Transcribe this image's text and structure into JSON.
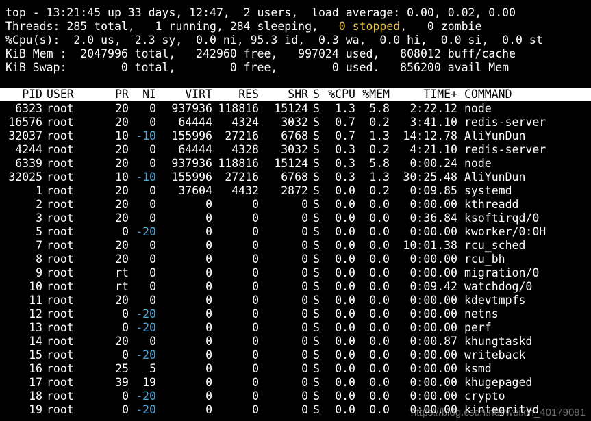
{
  "summary": {
    "line1": "top - 13:21:45 up 33 days, 12:47,  2 users,  load average: 0.00, 0.02, 0.00",
    "line2_before": "Threads: 285 total,   1 running, 284 sleeping,   ",
    "line2_stopped_count": "0",
    "line2_stopped_label": "stopped",
    "line2_after": ",   0 zombie",
    "line3": "%Cpu(s):  2.0 us,  2.3 sy,  0.0 ni, 95.3 id,  0.3 wa,  0.0 hi,  0.0 si,  0.0 st",
    "line4": "KiB Mem :  2047996 total,   242960 free,   997024 used,   808012 buff/cache",
    "line5": "KiB Swap:        0 total,        0 free,        0 used.   856200 avail Mem"
  },
  "columns": {
    "pid": "PID",
    "user": "USER",
    "pr": "PR",
    "ni": "NI",
    "virt": "VIRT",
    "res": "RES",
    "shr": "SHR",
    "s": "S",
    "cpu": "%CPU",
    "mem": "%MEM",
    "time": "TIME+",
    "command": "COMMAND"
  },
  "processes": [
    {
      "pid": "6323",
      "user": "root",
      "pr": "20",
      "ni": "0",
      "virt": "937936",
      "res": "118816",
      "shr": "15124",
      "s": "S",
      "cpu": "1.3",
      "mem": "5.8",
      "time": "2:22.12",
      "command": "node"
    },
    {
      "pid": "16576",
      "user": "root",
      "pr": "20",
      "ni": "0",
      "virt": "64444",
      "res": "4324",
      "shr": "3032",
      "s": "S",
      "cpu": "0.7",
      "mem": "0.2",
      "time": "3:41.10",
      "command": "redis-server"
    },
    {
      "pid": "32037",
      "user": "root",
      "pr": "10",
      "ni": "-10",
      "virt": "155996",
      "res": "27216",
      "shr": "6768",
      "s": "S",
      "cpu": "0.7",
      "mem": "1.3",
      "time": "14:12.78",
      "command": "AliYunDun"
    },
    {
      "pid": "4244",
      "user": "root",
      "pr": "20",
      "ni": "0",
      "virt": "64444",
      "res": "4328",
      "shr": "3032",
      "s": "S",
      "cpu": "0.3",
      "mem": "0.2",
      "time": "4:21.10",
      "command": "redis-server"
    },
    {
      "pid": "6339",
      "user": "root",
      "pr": "20",
      "ni": "0",
      "virt": "937936",
      "res": "118816",
      "shr": "15124",
      "s": "S",
      "cpu": "0.3",
      "mem": "5.8",
      "time": "0:00.24",
      "command": "node"
    },
    {
      "pid": "32025",
      "user": "root",
      "pr": "10",
      "ni": "-10",
      "virt": "155996",
      "res": "27216",
      "shr": "6768",
      "s": "S",
      "cpu": "0.3",
      "mem": "1.3",
      "time": "30:25.48",
      "command": "AliYunDun"
    },
    {
      "pid": "1",
      "user": "root",
      "pr": "20",
      "ni": "0",
      "virt": "37604",
      "res": "4432",
      "shr": "2872",
      "s": "S",
      "cpu": "0.0",
      "mem": "0.2",
      "time": "0:09.85",
      "command": "systemd"
    },
    {
      "pid": "2",
      "user": "root",
      "pr": "20",
      "ni": "0",
      "virt": "0",
      "res": "0",
      "shr": "0",
      "s": "S",
      "cpu": "0.0",
      "mem": "0.0",
      "time": "0:00.00",
      "command": "kthreadd"
    },
    {
      "pid": "3",
      "user": "root",
      "pr": "20",
      "ni": "0",
      "virt": "0",
      "res": "0",
      "shr": "0",
      "s": "S",
      "cpu": "0.0",
      "mem": "0.0",
      "time": "0:36.84",
      "command": "ksoftirqd/0"
    },
    {
      "pid": "5",
      "user": "root",
      "pr": "0",
      "ni": "-20",
      "virt": "0",
      "res": "0",
      "shr": "0",
      "s": "S",
      "cpu": "0.0",
      "mem": "0.0",
      "time": "0:00.00",
      "command": "kworker/0:0H"
    },
    {
      "pid": "7",
      "user": "root",
      "pr": "20",
      "ni": "0",
      "virt": "0",
      "res": "0",
      "shr": "0",
      "s": "S",
      "cpu": "0.0",
      "mem": "0.0",
      "time": "10:01.38",
      "command": "rcu_sched"
    },
    {
      "pid": "8",
      "user": "root",
      "pr": "20",
      "ni": "0",
      "virt": "0",
      "res": "0",
      "shr": "0",
      "s": "S",
      "cpu": "0.0",
      "mem": "0.0",
      "time": "0:00.00",
      "command": "rcu_bh"
    },
    {
      "pid": "9",
      "user": "root",
      "pr": "rt",
      "ni": "0",
      "virt": "0",
      "res": "0",
      "shr": "0",
      "s": "S",
      "cpu": "0.0",
      "mem": "0.0",
      "time": "0:00.00",
      "command": "migration/0"
    },
    {
      "pid": "10",
      "user": "root",
      "pr": "rt",
      "ni": "0",
      "virt": "0",
      "res": "0",
      "shr": "0",
      "s": "S",
      "cpu": "0.0",
      "mem": "0.0",
      "time": "0:09.42",
      "command": "watchdog/0"
    },
    {
      "pid": "11",
      "user": "root",
      "pr": "20",
      "ni": "0",
      "virt": "0",
      "res": "0",
      "shr": "0",
      "s": "S",
      "cpu": "0.0",
      "mem": "0.0",
      "time": "0:00.00",
      "command": "kdevtmpfs"
    },
    {
      "pid": "12",
      "user": "root",
      "pr": "0",
      "ni": "-20",
      "virt": "0",
      "res": "0",
      "shr": "0",
      "s": "S",
      "cpu": "0.0",
      "mem": "0.0",
      "time": "0:00.00",
      "command": "netns"
    },
    {
      "pid": "13",
      "user": "root",
      "pr": "0",
      "ni": "-20",
      "virt": "0",
      "res": "0",
      "shr": "0",
      "s": "S",
      "cpu": "0.0",
      "mem": "0.0",
      "time": "0:00.00",
      "command": "perf"
    },
    {
      "pid": "14",
      "user": "root",
      "pr": "20",
      "ni": "0",
      "virt": "0",
      "res": "0",
      "shr": "0",
      "s": "S",
      "cpu": "0.0",
      "mem": "0.0",
      "time": "0:00.87",
      "command": "khungtaskd"
    },
    {
      "pid": "15",
      "user": "root",
      "pr": "0",
      "ni": "-20",
      "virt": "0",
      "res": "0",
      "shr": "0",
      "s": "S",
      "cpu": "0.0",
      "mem": "0.0",
      "time": "0:00.00",
      "command": "writeback"
    },
    {
      "pid": "16",
      "user": "root",
      "pr": "25",
      "ni": "5",
      "virt": "0",
      "res": "0",
      "shr": "0",
      "s": "S",
      "cpu": "0.0",
      "mem": "0.0",
      "time": "0:00.00",
      "command": "ksmd"
    },
    {
      "pid": "17",
      "user": "root",
      "pr": "39",
      "ni": "19",
      "virt": "0",
      "res": "0",
      "shr": "0",
      "s": "S",
      "cpu": "0.0",
      "mem": "0.0",
      "time": "0:00.00",
      "command": "khugepaged"
    },
    {
      "pid": "18",
      "user": "root",
      "pr": "0",
      "ni": "-20",
      "virt": "0",
      "res": "0",
      "shr": "0",
      "s": "S",
      "cpu": "0.0",
      "mem": "0.0",
      "time": "0:00.00",
      "command": "crypto"
    },
    {
      "pid": "19",
      "user": "root",
      "pr": "0",
      "ni": "-20",
      "virt": "0",
      "res": "0",
      "shr": "0",
      "s": "S",
      "cpu": "0.0",
      "mem": "0.0",
      "time": "0:00.00",
      "command": "kintegrityd"
    }
  ],
  "watermark": "https://blog.csdn.net/weixin_40179091",
  "colors": {
    "background": "#000000",
    "foreground": "#ffffff",
    "stopped": "#e8c84a",
    "negative_nice": "#4aa8d8",
    "header_bg": "#ffffff",
    "header_fg": "#000000"
  }
}
